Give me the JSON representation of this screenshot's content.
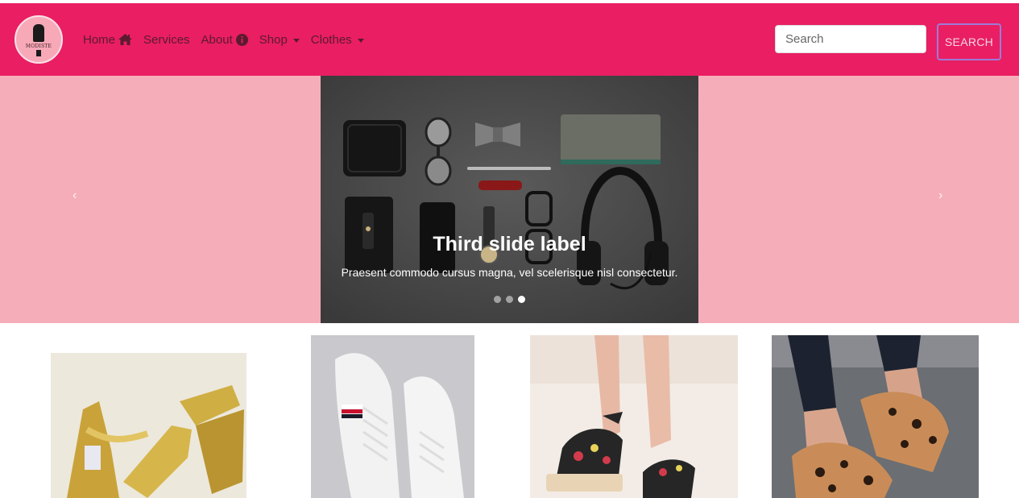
{
  "nav": {
    "logo_text": "MODISTE",
    "links": [
      {
        "label": "Home"
      },
      {
        "label": "Services"
      },
      {
        "label": "About"
      },
      {
        "label": "Shop"
      },
      {
        "label": "Clothes"
      }
    ],
    "search_placeholder": "Search",
    "search_button": "SEARCH"
  },
  "carousel": {
    "active_index": 2,
    "slides_count": 3,
    "caption_title": "Third slide label",
    "caption_text": "Praesent commodo cursus magna, vel scelerisque nisl consectetur."
  },
  "colors": {
    "navbar": "#e91e63",
    "carousel_bg": "#f5aeb9",
    "link": "#5b1b2e"
  },
  "products": [
    {
      "name": "gold-wedge-sandals"
    },
    {
      "name": "white-sneakers"
    },
    {
      "name": "floral-wedge-sandals"
    },
    {
      "name": "leopard-platform-sandals"
    }
  ]
}
